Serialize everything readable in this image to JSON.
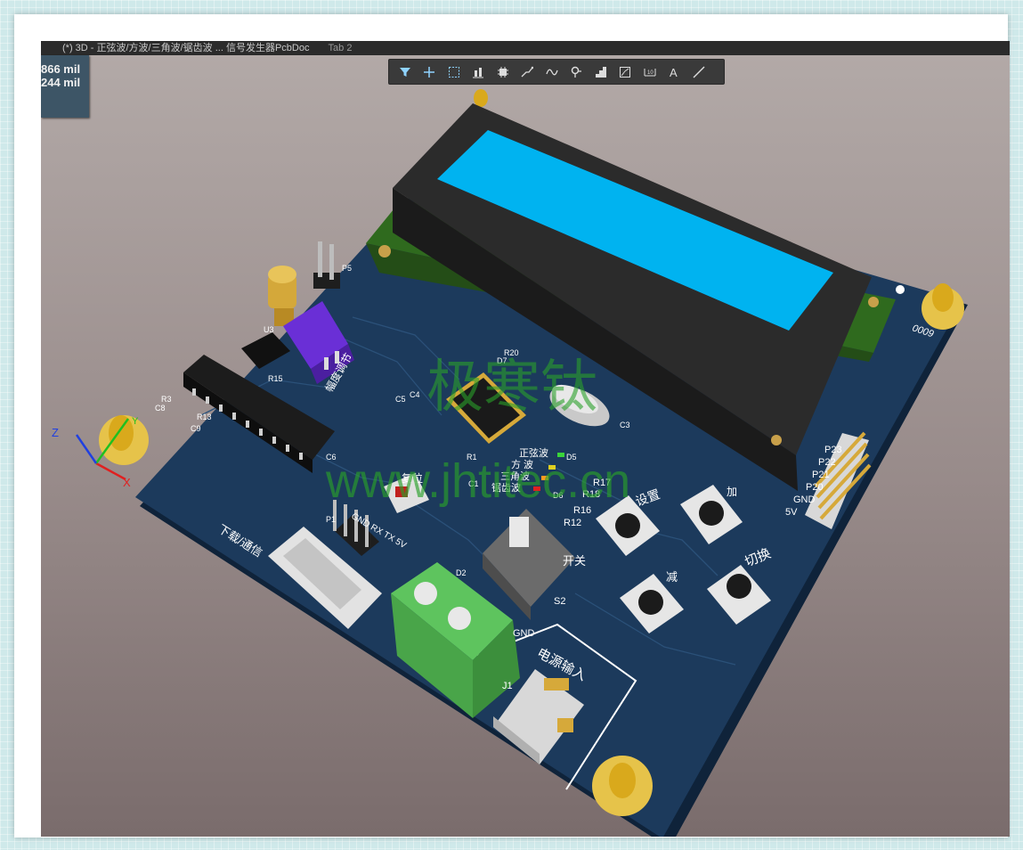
{
  "tab": {
    "title": "(*) 3D - 正弦波/方波/三角波/锯齿波 ... 信号发生器PcbDoc",
    "secondary": "Tab 2"
  },
  "coords": {
    "x": "866 mil",
    "y": "244 mil"
  },
  "toolbar": {
    "tools": [
      {
        "name": "filter",
        "icon": "filter-icon"
      },
      {
        "name": "add",
        "icon": "plus-icon"
      },
      {
        "name": "select",
        "icon": "select-rect-icon"
      },
      {
        "name": "align",
        "icon": "align-icon"
      },
      {
        "name": "component",
        "icon": "chip-icon"
      },
      {
        "name": "route",
        "icon": "route-icon"
      },
      {
        "name": "tune",
        "icon": "wave-icon"
      },
      {
        "name": "via",
        "icon": "pin-icon"
      },
      {
        "name": "polygon",
        "icon": "stair-icon"
      },
      {
        "name": "chart",
        "icon": "chart-icon"
      },
      {
        "name": "dimension",
        "icon": "dimension-icon"
      },
      {
        "name": "text",
        "icon": "text-icon"
      },
      {
        "name": "line",
        "icon": "line-icon"
      }
    ]
  },
  "board": {
    "watermark_cn": "极寒钛",
    "watermark_url": "www.jhtitec.cn",
    "labels": {
      "p5": "P5",
      "u3": "U3",
      "r15": "R15",
      "pot_label": "幅度调节",
      "r3": "R3",
      "c8": "C8",
      "r13": "R13",
      "c9": "C9",
      "c6": "C6",
      "r20": "R20",
      "d7": "D7",
      "c5": "C5",
      "c4": "C4",
      "c3": "C3",
      "r1": "R1",
      "c1": "C1",
      "reset": "复位",
      "sine": "正弦波",
      "square": "方 波",
      "triangle": "三角波",
      "sawtooth": "锯齿波",
      "d5": "D5",
      "r17": "R17",
      "r18": "R18",
      "r16": "R16",
      "d6": "D6",
      "r12": "R12",
      "set": "设置",
      "add": "加",
      "sub": "减",
      "switch": "切换",
      "p23": "P23",
      "p22": "P22",
      "p21": "P21",
      "p20": "P20",
      "gnd_hdr": "GND",
      "v5_hdr": "5V",
      "download": "下载/通信",
      "uart_pins": "GND RX TX 5V",
      "p1": "P1",
      "s2": "S2",
      "power_sw": "开关",
      "power_in": "电源输入",
      "j1": "J1",
      "gnd": "GND",
      "d2": "D2",
      "code": "0009"
    }
  },
  "axes": {
    "x": "X",
    "y": "Y",
    "z": "Z"
  },
  "colors": {
    "pcb": "#1c3a5c",
    "lcd_screen": "#00b3f0",
    "terminal": "#5ec45e",
    "pot": "#6a2fd6",
    "watermark": "#2aa02a"
  }
}
